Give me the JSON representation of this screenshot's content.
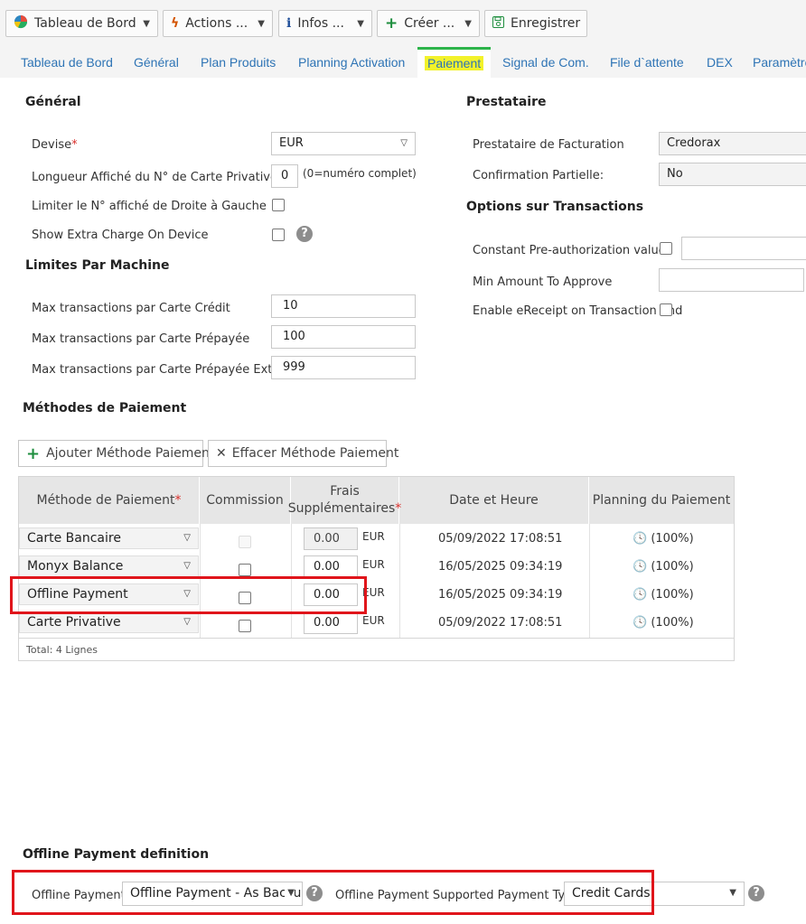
{
  "toolbar": {
    "dashboard": "Tableau de Bord",
    "actions": "Actions ...",
    "infos": "Infos ...",
    "create": "Créer ...",
    "save": "Enregistrer"
  },
  "tabs": [
    "Tableau de Bord",
    "Général",
    "Plan Produits",
    "Planning Activation",
    "Paiement",
    "Signal de Com.",
    "File d`attente",
    "DEX",
    "Paramètre"
  ],
  "general": {
    "title": "Général",
    "currency_label": "Devise",
    "currency_value": "EUR",
    "card_length_label": "Longueur Affiché du N° de Carte Privative",
    "card_length_value": "0",
    "card_length_hint": "(0=numéro complet)",
    "limit_rtl_label": "Limiter le N° affiché de Droite à Gauche",
    "extra_charge_label": "Show Extra Charge On Device"
  },
  "limits": {
    "title": "Limites Par Machine",
    "credit_label": "Max transactions par Carte Crédit",
    "credit_value": "10",
    "prepaid_label": "Max transactions par Carte Prépayée",
    "prepaid_value": "100",
    "prepaid_ext_label": "Max transactions par Carte Prépayée Externe",
    "prepaid_ext_value": "999"
  },
  "provider": {
    "title": "Prestataire",
    "billing_label": "Prestataire de Facturation",
    "billing_value": "Credorax",
    "partial_label": "Confirmation Partielle:",
    "partial_value": "No"
  },
  "options": {
    "title": "Options sur Transactions",
    "preauth_label": "Constant Pre-authorization value",
    "min_amount_label": "Min Amount To Approve",
    "ereceipt_label": "Enable eReceipt on Transaction end"
  },
  "methods": {
    "title": "Méthodes de Paiement",
    "add_button": "Ajouter Méthode Paiement",
    "delete_button": "Effacer Méthode Paiement",
    "headers": {
      "method": "Méthode de Paiement",
      "commission": "Commission",
      "fees_line1": "Frais",
      "fees_line2": "Supplémentaires",
      "datetime": "Date et Heure",
      "planning": "Planning du Paiement"
    },
    "rows": [
      {
        "method": "Carte Bancaire",
        "fee": "0.00",
        "currency": "EUR",
        "date": "05/09/2022 17:08:51",
        "planning": "(100%)"
      },
      {
        "method": "Monyx Balance",
        "fee": "0.00",
        "currency": "EUR",
        "date": "16/05/2025 09:34:19",
        "planning": "(100%)"
      },
      {
        "method": "Offline Payment",
        "fee": "0.00",
        "currency": "EUR",
        "date": "16/05/2025 09:34:19",
        "planning": "(100%)"
      },
      {
        "method": "Carte Privative",
        "fee": "0.00",
        "currency": "EUR",
        "date": "05/09/2022 17:08:51",
        "planning": "(100%)"
      }
    ],
    "total": "Total: 4 Lignes"
  },
  "offline": {
    "title": "Offline Payment definition",
    "payment_label": "Offline Payment",
    "payment_value": "Offline Payment - As Backup",
    "types_label": "Offline Payment Supported Payment Types",
    "types_value": "Credit Cards"
  },
  "colors": {
    "accent_tab": "#2db34a",
    "highlight": "#f2f22a",
    "link": "#2e74b5",
    "annotation": "#e0151b"
  }
}
